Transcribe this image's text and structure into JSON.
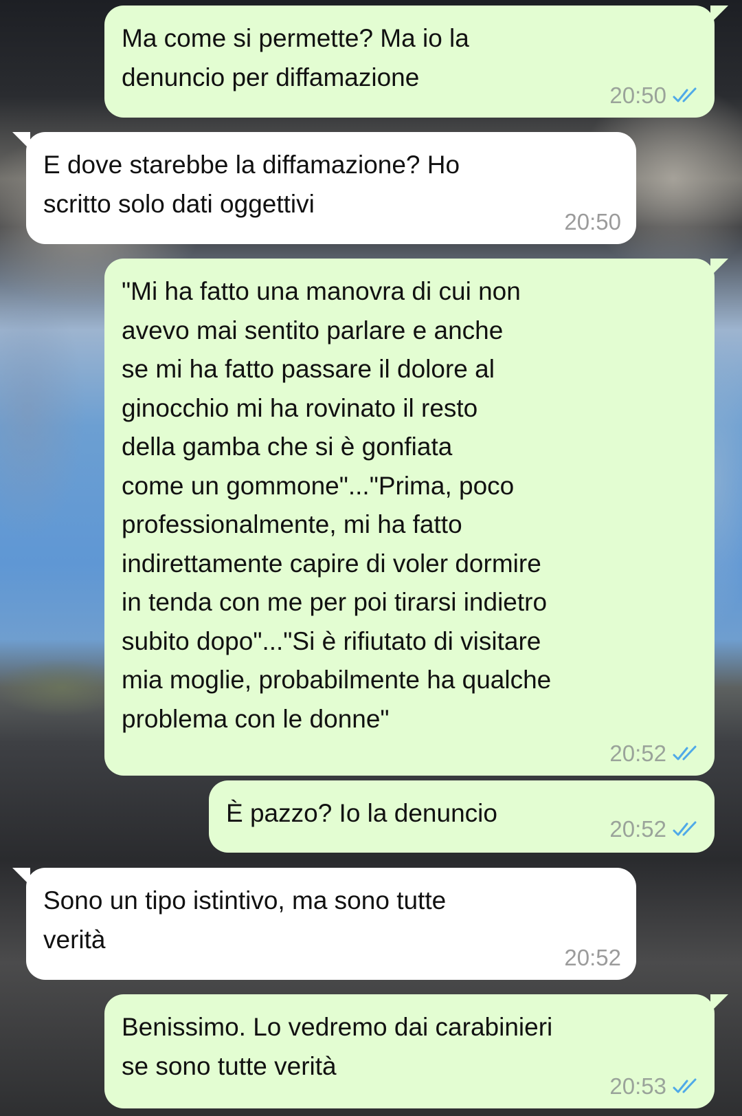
{
  "messages": [
    {
      "text": "Ma come si permette? Ma io la\ndenuncio per diffamazione",
      "time": "20:50",
      "direction": "outgoing",
      "status_icon": "double-check-read-icon"
    },
    {
      "text": "E dove starebbe la diffamazione? Ho\nscritto solo dati oggettivi",
      "time": "20:50",
      "direction": "incoming"
    },
    {
      "text": "\"Mi ha fatto una manovra di cui non\navevo mai sentito parlare e anche\nse mi ha fatto passare il dolore al\nginocchio mi ha rovinato il resto\ndella gamba che si è gonfiata\ncome un gommone\"...\"Prima, poco\nprofessionalmente, mi ha fatto\nindirettamente capire di voler dormire\nin tenda con me per poi tirarsi indietro\nsubito dopo\"...\"Si è rifiutato di visitare\nmia moglie, probabilmente ha qualche\nproblema con le donne\"",
      "time": "20:52",
      "direction": "outgoing",
      "status_icon": "double-check-read-icon"
    },
    {
      "text": "È pazzo? Io la denuncio",
      "time": "20:52",
      "direction": "outgoing",
      "status_icon": "double-check-read-icon"
    },
    {
      "text": "Sono un tipo istintivo, ma sono tutte\nverità",
      "time": "20:52",
      "direction": "incoming"
    },
    {
      "text": "Benissimo. Lo vedremo dai carabinieri\nse sono tutte verità",
      "time": "20:53",
      "direction": "outgoing",
      "status_icon": "double-check-read-icon"
    }
  ],
  "colors": {
    "outgoing_bubble": "#e3fdd2",
    "incoming_bubble": "#ffffff",
    "read_ticks": "#4fa9e8"
  }
}
